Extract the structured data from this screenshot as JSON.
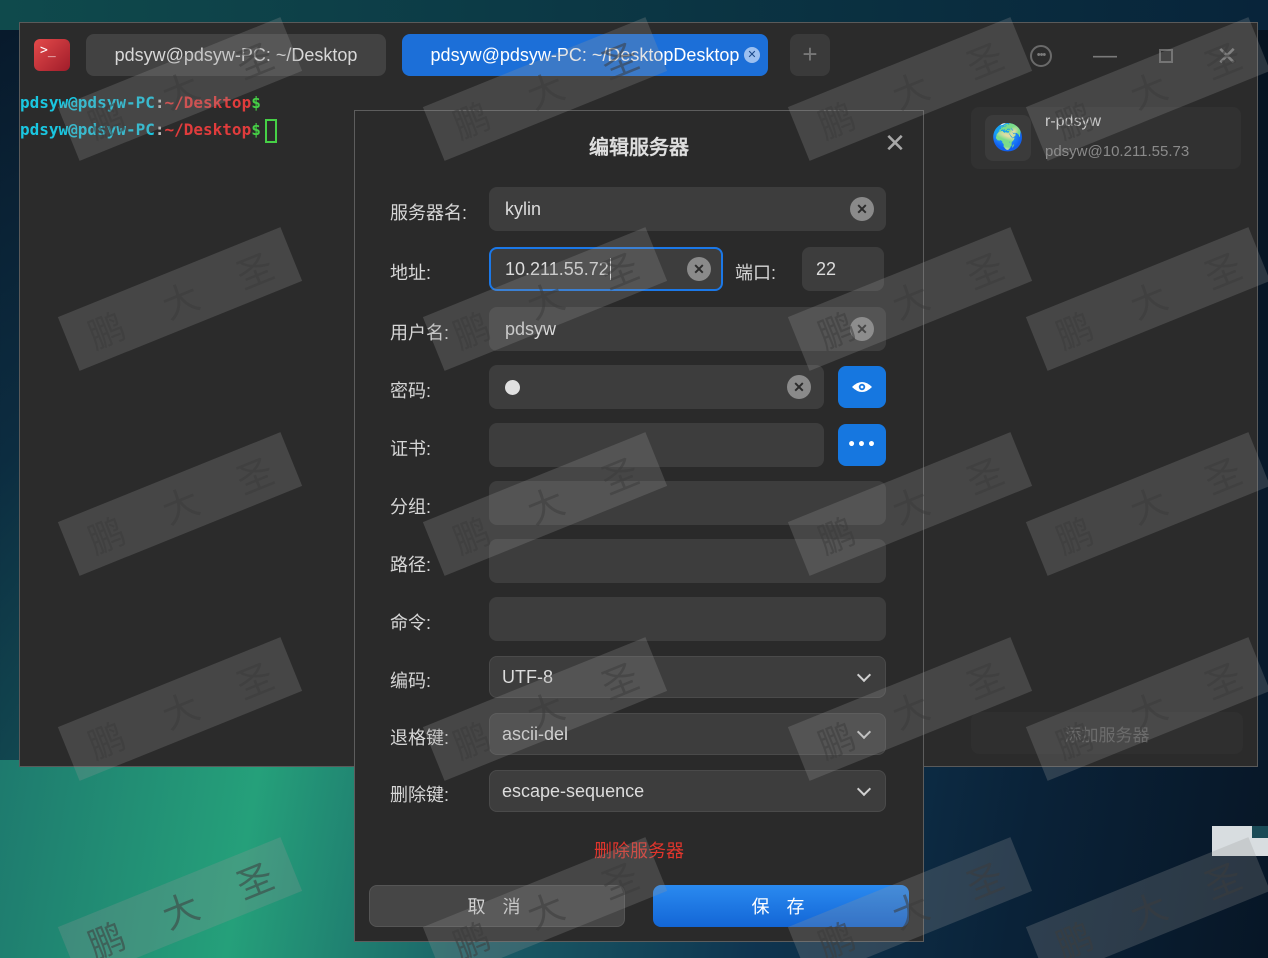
{
  "terminal": {
    "tabs": [
      {
        "label": "pdsyw@pdsyw-PC: ~/Desktop",
        "active": false
      },
      {
        "label": "pdsyw@pdsyw-PC: ~/DesktopDesktop",
        "active": true
      }
    ],
    "tab_add": "+",
    "prompt": {
      "user": "pdsyw@pdsyw-PC",
      "sep": ":",
      "dir": "~/Desktop",
      "sym": "$"
    },
    "colors": {
      "user": "#1ac6e0",
      "dir": "#e03c3c",
      "symbol": "#46d046"
    }
  },
  "server_panel": {
    "server": {
      "name": "r-pdsyw",
      "address": "pdsyw@10.211.55.73"
    },
    "add_button": "添加服务器"
  },
  "dialog": {
    "title": "编辑服务器",
    "labels": {
      "server_name": "服务器名:",
      "address": "地址:",
      "port": "端口:",
      "username": "用户名:",
      "password": "密码:",
      "certificate": "证书:",
      "group": "分组:",
      "path": "路径:",
      "command": "命令:",
      "encoding": "编码:",
      "backspace": "退格键:",
      "delete": "删除键:"
    },
    "values": {
      "server_name": "kylin",
      "address": "10.211.55.72",
      "port": "22",
      "username": "pdsyw",
      "password": "●",
      "certificate": "",
      "group": "",
      "path": "",
      "command": "",
      "encoding": "UTF-8",
      "backspace": "ascii-del",
      "delete": "escape-sequence"
    },
    "delete_server": "删除服务器",
    "cancel": "取 消",
    "save": "保 存"
  },
  "watermark": {
    "chars": [
      "鹏",
      "大",
      "圣"
    ]
  },
  "accent_color": "#1677e0"
}
